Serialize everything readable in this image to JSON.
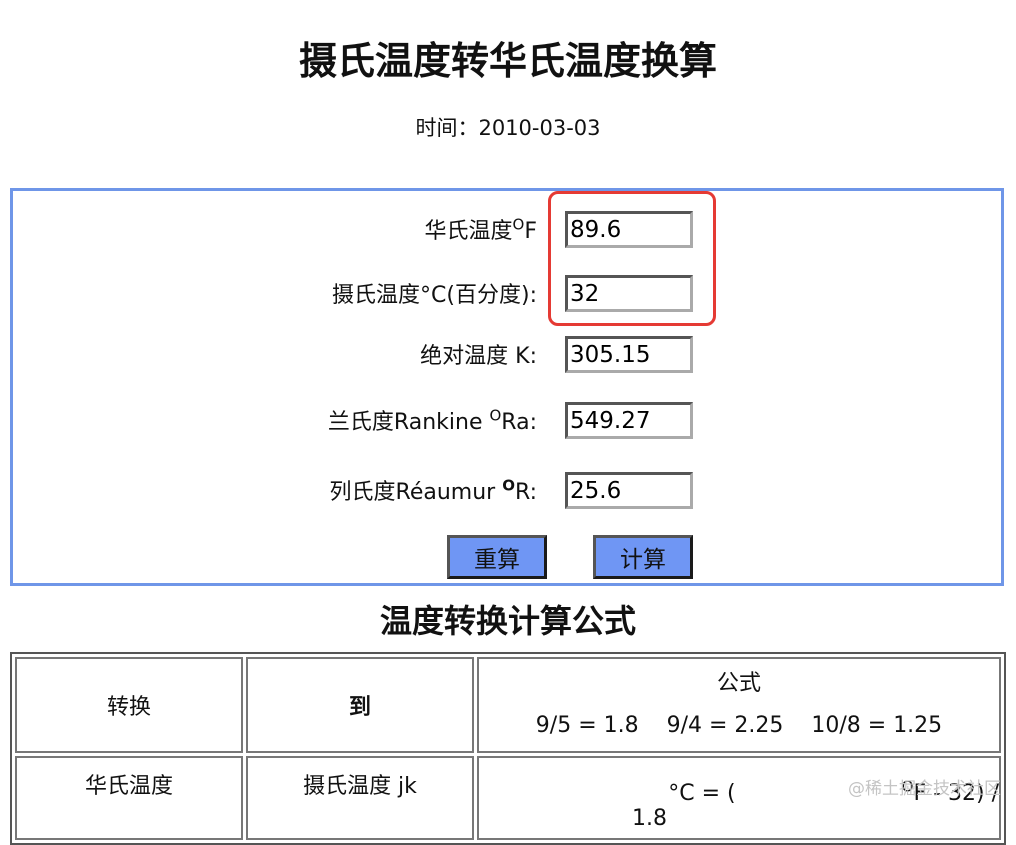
{
  "header": {
    "title": "摄氏温度转华氏温度换算",
    "date": "时间：2010-03-03"
  },
  "calculator": {
    "fields": [
      {
        "label_prefix": "华氏温度",
        "label_sup": "O",
        "label_suffix": "F",
        "value": "89.6"
      },
      {
        "label_prefix": "摄氏温度°C(百分度):",
        "label_sup": "",
        "label_suffix": "",
        "value": "32"
      },
      {
        "label_prefix": "绝对温度 K:",
        "label_sup": "",
        "label_suffix": "",
        "value": "305.15"
      },
      {
        "label_prefix": "兰氏度Rankine ",
        "label_sup": "O",
        "label_suffix": "Ra:",
        "value": "549.27"
      },
      {
        "label_prefix": "列氏度Réaumur ",
        "label_sup": "O",
        "label_suffix": "R:",
        "value": "25.6"
      }
    ],
    "reset_label": "重算",
    "calc_label": "计算",
    "highlight_color": "#e53a34",
    "border_color": "#6f96e8",
    "button_color": "#6f96f4"
  },
  "formula_section": {
    "title": "温度转换计算公式",
    "headers": {
      "col1": "转换",
      "col2": "到",
      "col3_title": "公式",
      "col3_values": "9/5 = 1.8    9/4 = 2.25    10/8 = 1.25"
    },
    "rows": [
      {
        "from": "华氏温度",
        "to": "摄氏温度 jk",
        "formula_prefix": "°C = (",
        "formula_sup": "O",
        "formula_suffix": "F - 32) / 1.8"
      }
    ]
  },
  "watermark": "@稀土掘金技术社区"
}
